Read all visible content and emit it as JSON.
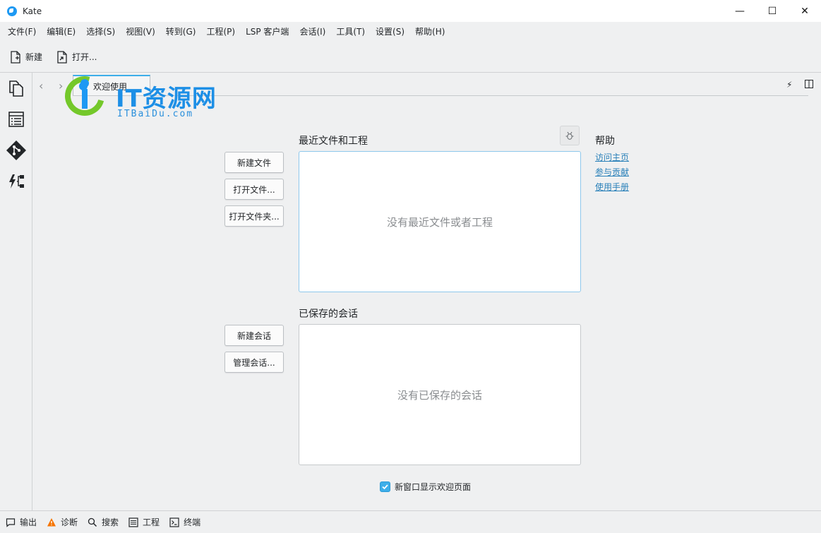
{
  "window": {
    "title": "Kate"
  },
  "window_controls": {
    "minimize": "—",
    "maximize": "☐",
    "close": "✕"
  },
  "menu": [
    "文件(F)",
    "编辑(E)",
    "选择(S)",
    "视图(V)",
    "转到(G)",
    "工程(P)",
    "LSP 客户端",
    "会话(I)",
    "工具(T)",
    "设置(S)",
    "帮助(H)"
  ],
  "toolbar": {
    "new_label": "新建",
    "open_label": "打开..."
  },
  "tab": {
    "label": "欢迎使用"
  },
  "watermark": {
    "main": "IT资源网",
    "sub": "ITBaiDu.com"
  },
  "recent": {
    "title": "最近文件和工程",
    "empty": "没有最近文件或者工程",
    "new_file": "新建文件",
    "open_file": "打开文件...",
    "open_folder": "打开文件夹..."
  },
  "sessions": {
    "title": "已保存的会话",
    "empty": "没有已保存的会话",
    "new_session": "新建会话",
    "manage_sessions": "管理会话..."
  },
  "help": {
    "title": "帮助",
    "links": [
      "访问主页",
      "参与贡献",
      "使用手册"
    ]
  },
  "show_welcome": {
    "label": "新窗口显示欢迎页面",
    "checked": true
  },
  "statusbar": [
    "输出",
    "诊断",
    "搜索",
    "工程",
    "终端"
  ],
  "colors": {
    "accent": "#3daee9",
    "link": "#2980b9",
    "warning": "#f67400"
  }
}
